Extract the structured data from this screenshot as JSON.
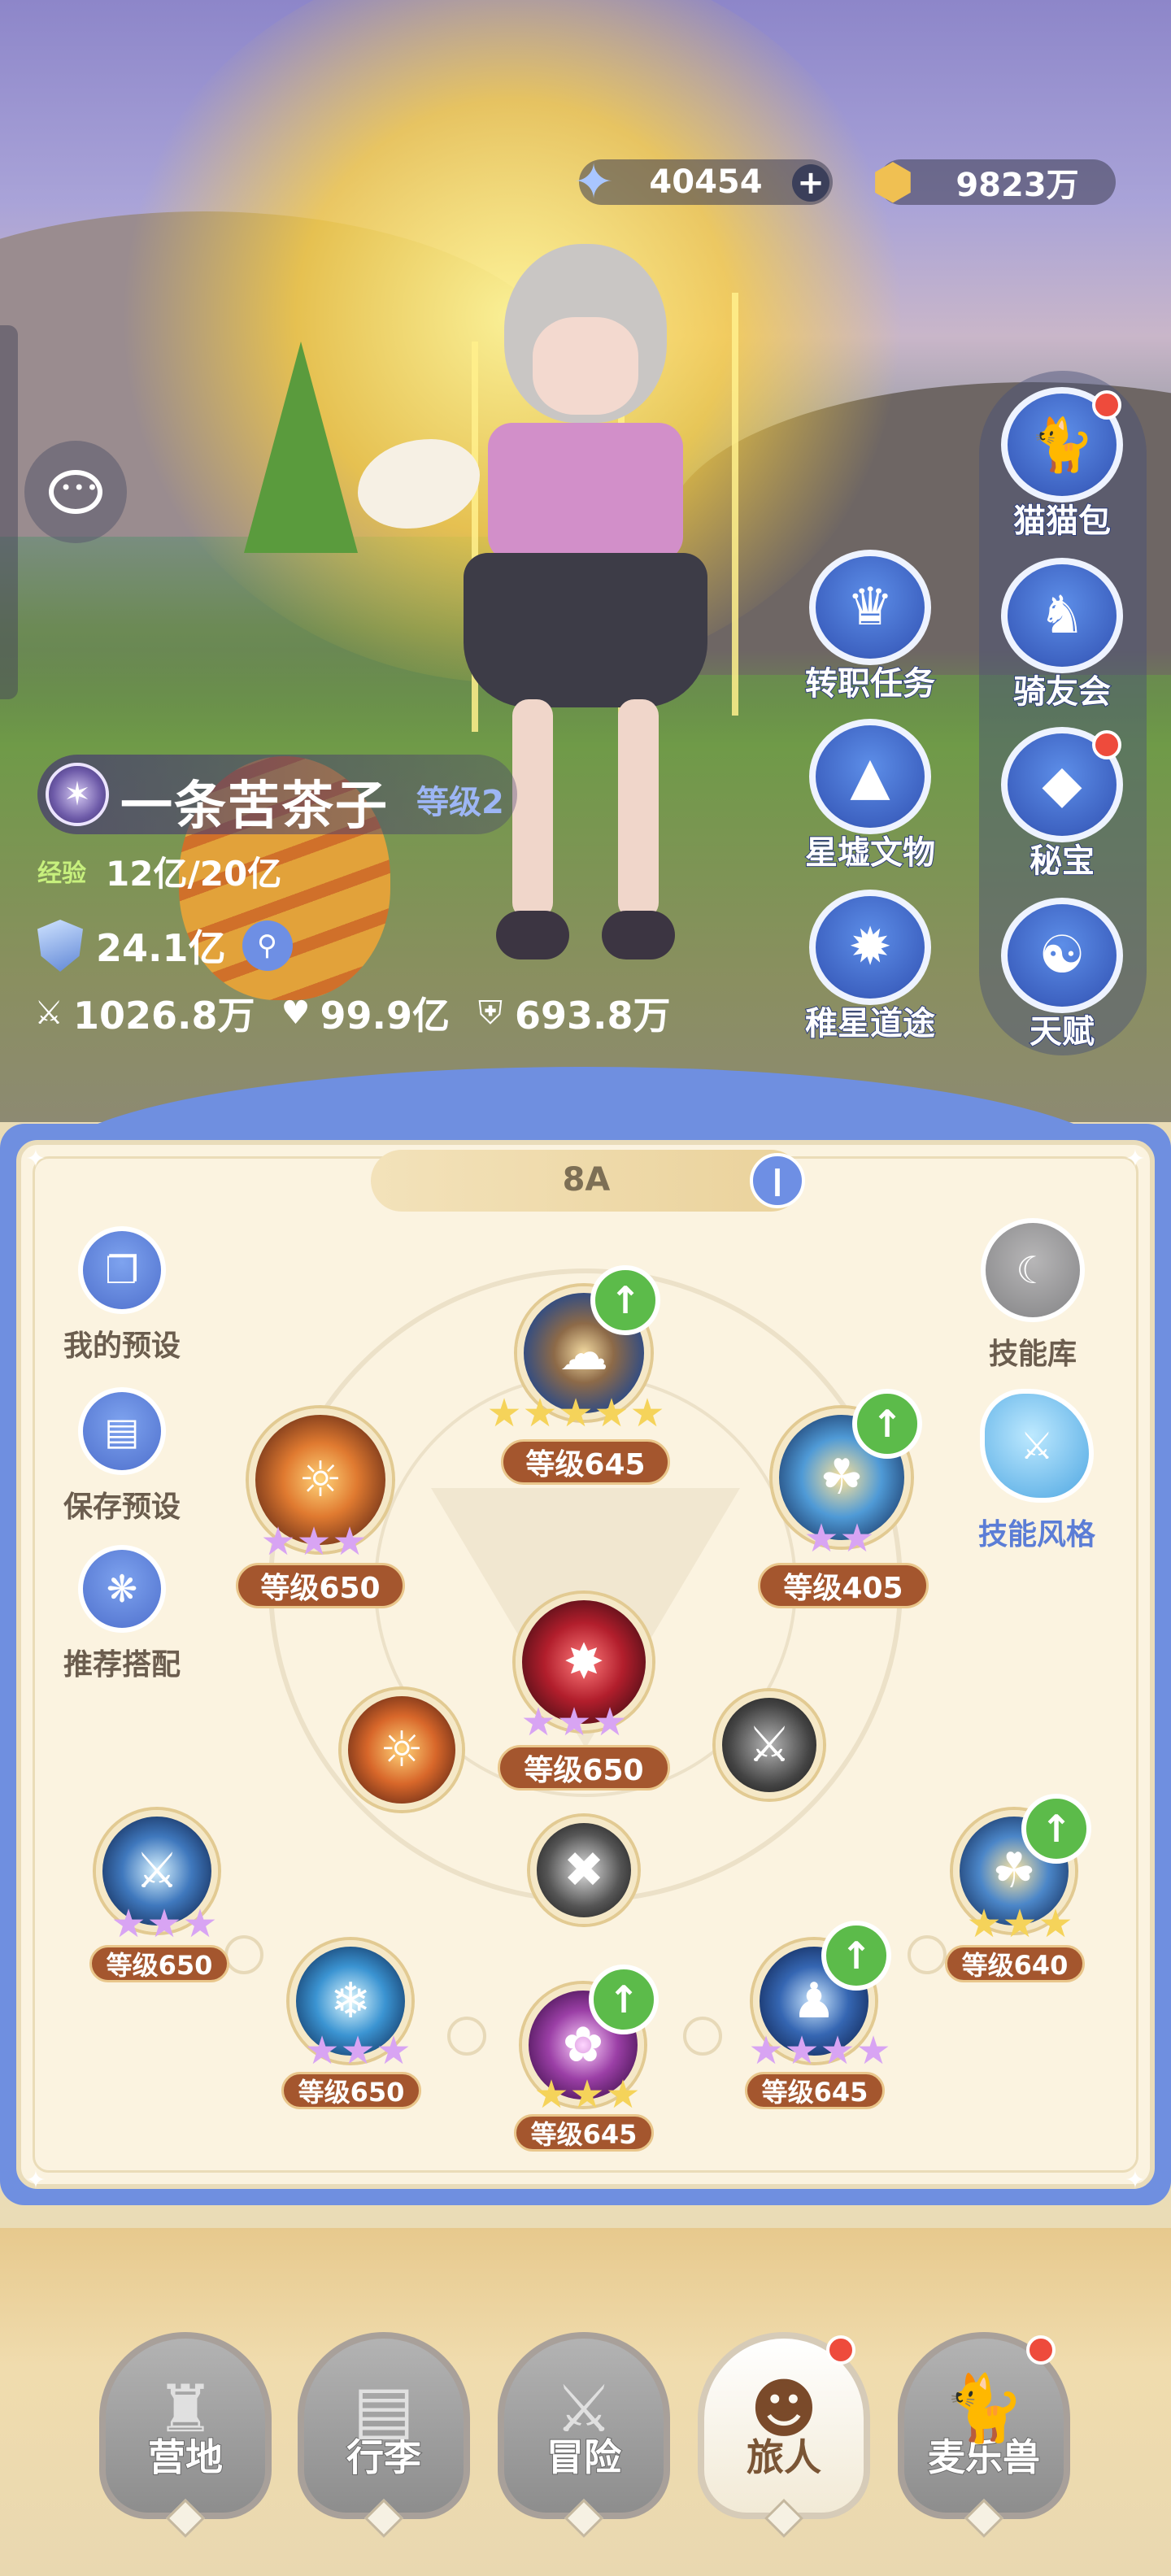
{
  "currencies": {
    "stars": {
      "value": "40454",
      "plus": "+",
      "icon": "star-crystal-icon"
    },
    "gold": {
      "value": "9823万",
      "icon": "gold-coin-icon"
    }
  },
  "player": {
    "name": "一条苦茶子",
    "level": "等级2",
    "exp_label": "经验",
    "exp_value": "12亿/20亿",
    "power": "24.1亿",
    "attack": "1026.8万",
    "hp": "99.9亿",
    "defense": "693.8万"
  },
  "right_menu": [
    {
      "label": "猫猫包",
      "badge": true
    },
    {
      "label": "转职任务",
      "badge": false
    },
    {
      "label": "骑友会",
      "badge": false
    },
    {
      "label": "星墟文物",
      "badge": false
    },
    {
      "label": "秘宝",
      "badge": true
    },
    {
      "label": "稚星道途",
      "badge": false
    },
    {
      "label": "天赋",
      "badge": false
    }
  ],
  "skill_panel": {
    "loadout_name": "8A",
    "left_actions": [
      {
        "label": "我的预设"
      },
      {
        "label": "保存预设"
      },
      {
        "label": "推荐搭配"
      }
    ],
    "right_actions": [
      {
        "label": "技能库"
      },
      {
        "label": "技能风格"
      }
    ],
    "skills": [
      {
        "level": "等级645",
        "stars": 5,
        "star_color": "gold",
        "upgrade": true,
        "color": "#2b4a86"
      },
      {
        "level": "等级650",
        "stars": 3,
        "star_color": "pink",
        "upgrade": false,
        "color": "#c0562a"
      },
      {
        "level": "等级405",
        "stars": 2,
        "star_color": "pink",
        "upgrade": true,
        "color": "#2e6cb0"
      },
      {
        "level": "等级650",
        "stars": 3,
        "star_color": "pink",
        "upgrade": false,
        "color": "#7d1a26"
      },
      {
        "level": "等级650",
        "stars": 3,
        "star_color": "pink",
        "upgrade": false,
        "color": "#1f4f86"
      },
      {
        "level": "等级640",
        "stars": 3,
        "star_color": "gold",
        "upgrade": true,
        "color": "#2f65a8"
      },
      {
        "level": "等级650",
        "stars": 3,
        "star_color": "pink",
        "upgrade": false,
        "color": "#2b74b5"
      },
      {
        "level": "等级645",
        "stars": 3,
        "star_color": "gold",
        "upgrade": true,
        "color": "#6c2f7a"
      },
      {
        "level": "等级645",
        "stars": 4,
        "star_color": "pink",
        "upgrade": true,
        "color": "#243f7c"
      }
    ]
  },
  "bottom_nav": [
    {
      "label": "营地",
      "active": false,
      "icon": "castle-icon",
      "badge": false
    },
    {
      "label": "行李",
      "active": false,
      "icon": "backpack-icon",
      "badge": false
    },
    {
      "label": "冒险",
      "active": false,
      "icon": "crossed-swords-icon",
      "badge": false
    },
    {
      "label": "旅人",
      "active": true,
      "icon": "traveler-avatar-icon",
      "badge": true
    },
    {
      "label": "麦乐兽",
      "active": false,
      "icon": "cat-pet-icon",
      "badge": true
    }
  ],
  "colors": {
    "accent_blue": "#6f8fe0",
    "level_tag": "#a4562e",
    "badge_red": "#ee4b3c",
    "upgrade_green": "#5cbb4a"
  }
}
